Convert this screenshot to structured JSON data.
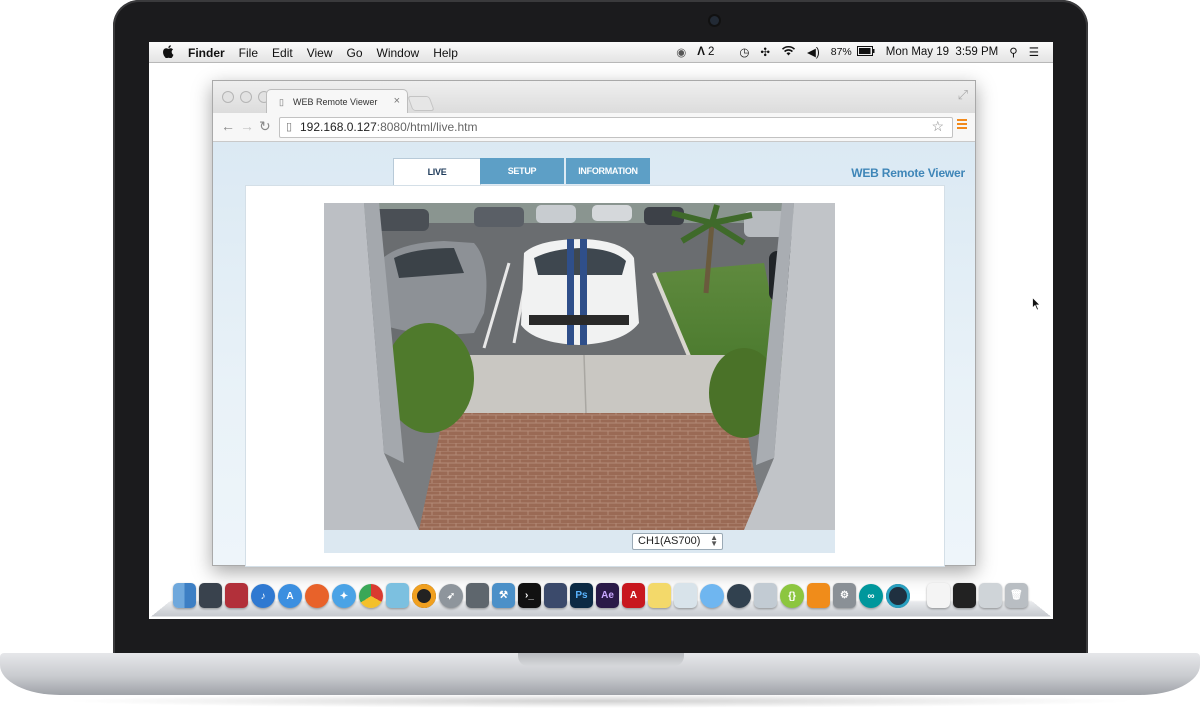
{
  "menubar": {
    "apple": "",
    "app": "Finder",
    "items": [
      "File",
      "Edit",
      "View",
      "Go",
      "Window",
      "Help"
    ],
    "status": {
      "adobe_count": "2",
      "battery": "87%",
      "datetime": "Mon May 19  3:59 PM"
    }
  },
  "browser": {
    "tab_title": "WEB Remote Viewer",
    "url_host": "192.168.0.127",
    "url_rest": ":8080/html/live.htm"
  },
  "page": {
    "tabs": [
      "LIVE",
      "SETUP",
      "INFORMATION"
    ],
    "active_tab": "LIVE",
    "brand": "WEB Remote Viewer",
    "channel_select": "CH1(AS700)"
  },
  "dock": {
    "icons": [
      "finder-icon",
      "launchpad-icon",
      "photo-booth-icon",
      "itunes-icon",
      "app-store-icon",
      "firefox-icon",
      "safari-icon",
      "chrome-icon",
      "island-icon",
      "disk-icon",
      "rocket-icon",
      "server-icon",
      "xcode-icon",
      "terminal-icon",
      "tablet-icon",
      "photoshop-icon",
      "after-effects-icon",
      "acrobat-icon",
      "notes-icon",
      "preview-icon",
      "messages-icon",
      "photos-icon",
      "mail-icon",
      "script-icon",
      "ibooks-icon",
      "system-preferences-icon",
      "arduino-icon",
      "radar-icon",
      "document-icon",
      "console-icon",
      "pencil-icon",
      "trash-icon"
    ],
    "labels": {
      "photoshop": "Ps",
      "after_effects": "Ae"
    }
  },
  "colors": {
    "accent": "#5d9fc6",
    "brand_text": "#3f86b8",
    "menu_icon": "#f28a1c"
  }
}
